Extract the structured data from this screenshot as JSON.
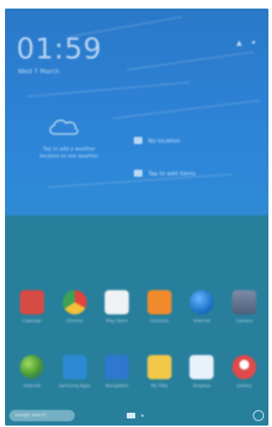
{
  "colors": {
    "widget_blue": "#2e86d9",
    "home_teal": "#277f9c",
    "text_light": "#e6f5ff"
  },
  "lock_widget": {
    "time": "01:59",
    "date": "Wed 7 March",
    "weather_message": "Tap to add a weather location to see weather",
    "action_1": "No location",
    "action_2": "Tap to add items"
  },
  "status_icons": [
    "signal-icon",
    "settings-icon"
  ],
  "apps": {
    "row1": [
      {
        "label": "Calendar",
        "icon": "calendar-icon",
        "color": "#d64b43"
      },
      {
        "label": "Chrome",
        "icon": "chrome-icon",
        "color": "#e0a52a"
      },
      {
        "label": "Play Store",
        "icon": "play-store-icon",
        "color": "#eef2f5"
      },
      {
        "label": "Contacts",
        "icon": "contacts-icon",
        "color": "#f08a2c"
      },
      {
        "label": "Internet",
        "icon": "internet-icon",
        "color": "#1f74c8"
      },
      {
        "label": "Camera",
        "icon": "camera-icon",
        "color": "#5b6f8a"
      }
    ],
    "row2": [
      {
        "label": "Internet",
        "icon": "globe-icon",
        "color": "#4c9b34"
      },
      {
        "label": "Samsung Apps",
        "icon": "apps-icon",
        "color": "#2b8ad1"
      },
      {
        "label": "Navigation",
        "icon": "navigation-icon",
        "color": "#2f78cf"
      },
      {
        "label": "My Files",
        "icon": "folder-icon",
        "color": "#f2c84a"
      },
      {
        "label": "Dropbox",
        "icon": "dropbox-icon",
        "color": "#e9f2fb"
      },
      {
        "label": "Gallery",
        "icon": "gallery-icon",
        "color": "#e04a4a"
      }
    ]
  },
  "bottom_bar": {
    "search_text": "Google Search",
    "page_indicator": "apps-grid-icon"
  }
}
